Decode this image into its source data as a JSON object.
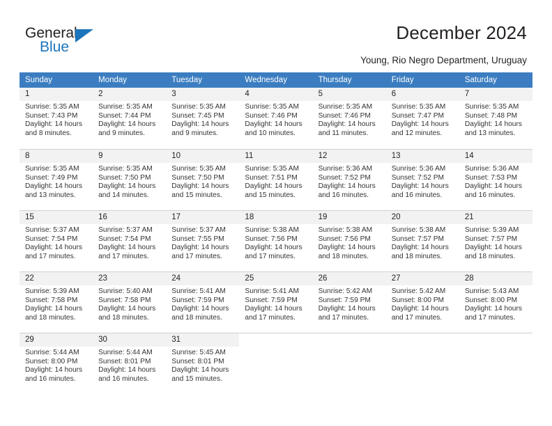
{
  "logo": {
    "word_top": "General",
    "word_bottom": "Blue",
    "triangle_color": "#1b75bb"
  },
  "header": {
    "title": "December 2024",
    "subtitle": "Young, Rio Negro Department, Uruguay"
  },
  "colors": {
    "header_row": "#3b7dc0",
    "day_number_bg": "#f2f2f2",
    "grid_line": "#cfcfcf",
    "text": "#231f20"
  },
  "calendar": {
    "weekdays": [
      "Sunday",
      "Monday",
      "Tuesday",
      "Wednesday",
      "Thursday",
      "Friday",
      "Saturday"
    ],
    "weeks": [
      [
        {
          "day": "1",
          "sunrise": "Sunrise: 5:35 AM",
          "sunset": "Sunset: 7:43 PM",
          "daylight": "Daylight: 14 hours and 8 minutes."
        },
        {
          "day": "2",
          "sunrise": "Sunrise: 5:35 AM",
          "sunset": "Sunset: 7:44 PM",
          "daylight": "Daylight: 14 hours and 9 minutes."
        },
        {
          "day": "3",
          "sunrise": "Sunrise: 5:35 AM",
          "sunset": "Sunset: 7:45 PM",
          "daylight": "Daylight: 14 hours and 9 minutes."
        },
        {
          "day": "4",
          "sunrise": "Sunrise: 5:35 AM",
          "sunset": "Sunset: 7:46 PM",
          "daylight": "Daylight: 14 hours and 10 minutes."
        },
        {
          "day": "5",
          "sunrise": "Sunrise: 5:35 AM",
          "sunset": "Sunset: 7:46 PM",
          "daylight": "Daylight: 14 hours and 11 minutes."
        },
        {
          "day": "6",
          "sunrise": "Sunrise: 5:35 AM",
          "sunset": "Sunset: 7:47 PM",
          "daylight": "Daylight: 14 hours and 12 minutes."
        },
        {
          "day": "7",
          "sunrise": "Sunrise: 5:35 AM",
          "sunset": "Sunset: 7:48 PM",
          "daylight": "Daylight: 14 hours and 13 minutes."
        }
      ],
      [
        {
          "day": "8",
          "sunrise": "Sunrise: 5:35 AM",
          "sunset": "Sunset: 7:49 PM",
          "daylight": "Daylight: 14 hours and 13 minutes."
        },
        {
          "day": "9",
          "sunrise": "Sunrise: 5:35 AM",
          "sunset": "Sunset: 7:50 PM",
          "daylight": "Daylight: 14 hours and 14 minutes."
        },
        {
          "day": "10",
          "sunrise": "Sunrise: 5:35 AM",
          "sunset": "Sunset: 7:50 PM",
          "daylight": "Daylight: 14 hours and 15 minutes."
        },
        {
          "day": "11",
          "sunrise": "Sunrise: 5:35 AM",
          "sunset": "Sunset: 7:51 PM",
          "daylight": "Daylight: 14 hours and 15 minutes."
        },
        {
          "day": "12",
          "sunrise": "Sunrise: 5:36 AM",
          "sunset": "Sunset: 7:52 PM",
          "daylight": "Daylight: 14 hours and 16 minutes."
        },
        {
          "day": "13",
          "sunrise": "Sunrise: 5:36 AM",
          "sunset": "Sunset: 7:52 PM",
          "daylight": "Daylight: 14 hours and 16 minutes."
        },
        {
          "day": "14",
          "sunrise": "Sunrise: 5:36 AM",
          "sunset": "Sunset: 7:53 PM",
          "daylight": "Daylight: 14 hours and 16 minutes."
        }
      ],
      [
        {
          "day": "15",
          "sunrise": "Sunrise: 5:37 AM",
          "sunset": "Sunset: 7:54 PM",
          "daylight": "Daylight: 14 hours and 17 minutes."
        },
        {
          "day": "16",
          "sunrise": "Sunrise: 5:37 AM",
          "sunset": "Sunset: 7:54 PM",
          "daylight": "Daylight: 14 hours and 17 minutes."
        },
        {
          "day": "17",
          "sunrise": "Sunrise: 5:37 AM",
          "sunset": "Sunset: 7:55 PM",
          "daylight": "Daylight: 14 hours and 17 minutes."
        },
        {
          "day": "18",
          "sunrise": "Sunrise: 5:38 AM",
          "sunset": "Sunset: 7:56 PM",
          "daylight": "Daylight: 14 hours and 17 minutes."
        },
        {
          "day": "19",
          "sunrise": "Sunrise: 5:38 AM",
          "sunset": "Sunset: 7:56 PM",
          "daylight": "Daylight: 14 hours and 18 minutes."
        },
        {
          "day": "20",
          "sunrise": "Sunrise: 5:38 AM",
          "sunset": "Sunset: 7:57 PM",
          "daylight": "Daylight: 14 hours and 18 minutes."
        },
        {
          "day": "21",
          "sunrise": "Sunrise: 5:39 AM",
          "sunset": "Sunset: 7:57 PM",
          "daylight": "Daylight: 14 hours and 18 minutes."
        }
      ],
      [
        {
          "day": "22",
          "sunrise": "Sunrise: 5:39 AM",
          "sunset": "Sunset: 7:58 PM",
          "daylight": "Daylight: 14 hours and 18 minutes."
        },
        {
          "day": "23",
          "sunrise": "Sunrise: 5:40 AM",
          "sunset": "Sunset: 7:58 PM",
          "daylight": "Daylight: 14 hours and 18 minutes."
        },
        {
          "day": "24",
          "sunrise": "Sunrise: 5:41 AM",
          "sunset": "Sunset: 7:59 PM",
          "daylight": "Daylight: 14 hours and 18 minutes."
        },
        {
          "day": "25",
          "sunrise": "Sunrise: 5:41 AM",
          "sunset": "Sunset: 7:59 PM",
          "daylight": "Daylight: 14 hours and 17 minutes."
        },
        {
          "day": "26",
          "sunrise": "Sunrise: 5:42 AM",
          "sunset": "Sunset: 7:59 PM",
          "daylight": "Daylight: 14 hours and 17 minutes."
        },
        {
          "day": "27",
          "sunrise": "Sunrise: 5:42 AM",
          "sunset": "Sunset: 8:00 PM",
          "daylight": "Daylight: 14 hours and 17 minutes."
        },
        {
          "day": "28",
          "sunrise": "Sunrise: 5:43 AM",
          "sunset": "Sunset: 8:00 PM",
          "daylight": "Daylight: 14 hours and 17 minutes."
        }
      ],
      [
        {
          "day": "29",
          "sunrise": "Sunrise: 5:44 AM",
          "sunset": "Sunset: 8:00 PM",
          "daylight": "Daylight: 14 hours and 16 minutes."
        },
        {
          "day": "30",
          "sunrise": "Sunrise: 5:44 AM",
          "sunset": "Sunset: 8:01 PM",
          "daylight": "Daylight: 14 hours and 16 minutes."
        },
        {
          "day": "31",
          "sunrise": "Sunrise: 5:45 AM",
          "sunset": "Sunset: 8:01 PM",
          "daylight": "Daylight: 14 hours and 15 minutes."
        },
        {
          "day": "",
          "sunrise": "",
          "sunset": "",
          "daylight": ""
        },
        {
          "day": "",
          "sunrise": "",
          "sunset": "",
          "daylight": ""
        },
        {
          "day": "",
          "sunrise": "",
          "sunset": "",
          "daylight": ""
        },
        {
          "day": "",
          "sunrise": "",
          "sunset": "",
          "daylight": ""
        }
      ]
    ]
  }
}
